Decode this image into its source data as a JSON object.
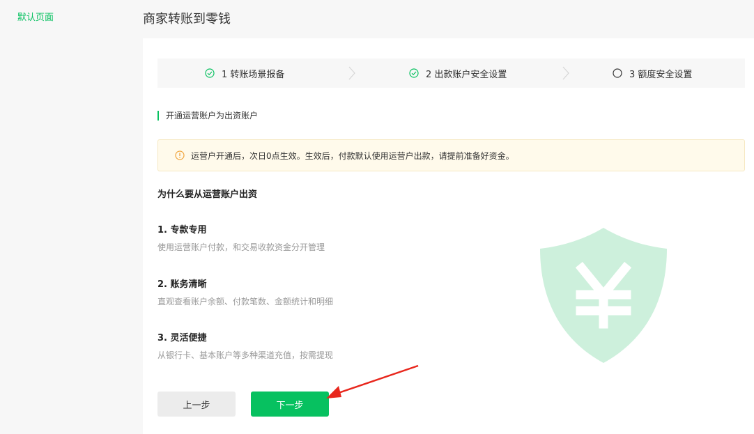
{
  "sidebar": {
    "items": [
      {
        "label": "默认页面"
      }
    ]
  },
  "header": {
    "title": "商家转账到零钱"
  },
  "steps": [
    {
      "label": "1 转账场景报备",
      "state": "done"
    },
    {
      "label": "2 出款账户安全设置",
      "state": "done"
    },
    {
      "label": "3 额度安全设置",
      "state": "pending"
    }
  ],
  "section": {
    "title": "开通运营账户为出资账户"
  },
  "notice": {
    "text": "运营户开通后，次日0点生效。生效后，付款默认使用运营户出款，请提前准备好资金。"
  },
  "why": {
    "title": "为什么要从运营账户出资"
  },
  "reasons": [
    {
      "title": "1. 专款专用",
      "desc": "使用运营账户付款，和交易收款资金分开管理"
    },
    {
      "title": "2. 账务清晰",
      "desc": "直观查看账户余额、付款笔数、金额统计和明细"
    },
    {
      "title": "3. 灵活便捷",
      "desc": "从银行卡、基本账户等多种渠道充值，按需提现"
    }
  ],
  "buttons": {
    "prev": "上一步",
    "next": "下一步"
  },
  "colors": {
    "accent": "#07c160",
    "shield": "#cdf0dc",
    "annotation_arrow": "#e8261c"
  }
}
